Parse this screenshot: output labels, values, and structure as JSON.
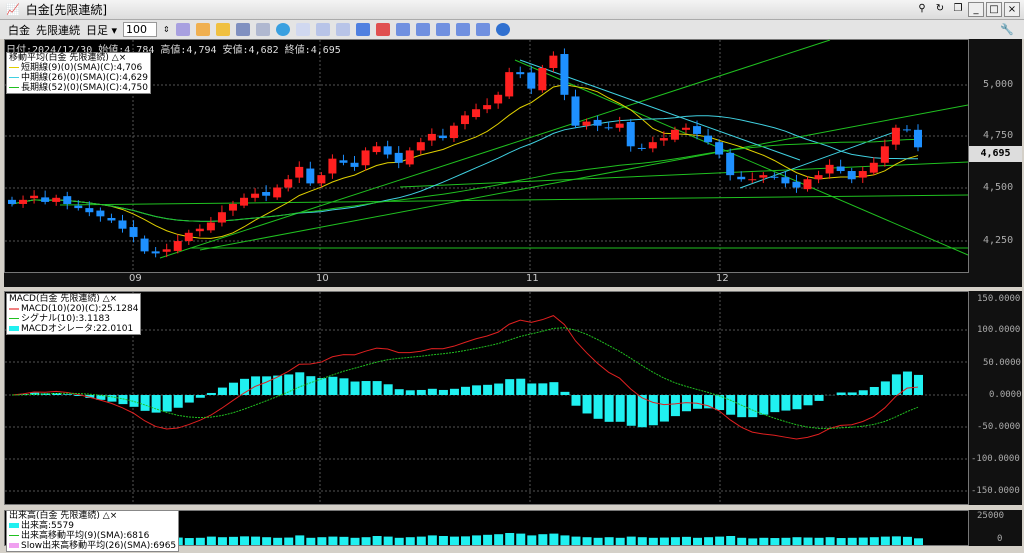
{
  "window": {
    "title": "白金[先限連続]"
  },
  "toolbar": {
    "symbol": "白金",
    "contract": "先限連続",
    "period": "日足",
    "count": "100"
  },
  "info": {
    "text": "日付:2024/12/30 始値:4,784 高値:4,794 安値:4,682 終値:4,695"
  },
  "ma_legend": {
    "title": "移動平均(白金 先限連続)",
    "items": [
      "短期線(9)(0)(SMA)(C):4,706",
      "中期線(26)(0)(SMA)(C):4,629",
      "長期線(52)(0)(SMA)(C):4,750"
    ]
  },
  "macd_legend": {
    "title": "MACD(白金 先限連続)",
    "items": [
      "MACD(10)(20)(C):25.1284",
      "シグナル(10):3.1183",
      "MACDオシレータ:22.0101"
    ]
  },
  "vol_legend": {
    "title": "出来高(白金 先限連続)",
    "items": [
      "出来高:5579",
      "出来高移動平均(9)(SMA):6816",
      "Slow出来高移動平均(26)(SMA):6965"
    ]
  },
  "price_axis": {
    "ticks": [
      "5,000",
      "4,750",
      "4,500",
      "4,250"
    ],
    "current": "4,695"
  },
  "macd_axis": {
    "ticks": [
      "150.0000",
      "100.0000",
      "50.0000",
      "0.0000",
      "-50.0000",
      "-100.0000",
      "-150.0000"
    ]
  },
  "vol_axis": {
    "ticks": [
      "25000",
      "0"
    ]
  },
  "x_axis": {
    "labels": [
      "09",
      "10",
      "11",
      "12"
    ]
  },
  "colors": {
    "up": "#ff2020",
    "down": "#1e90ff",
    "short": "#e0d000",
    "mid": "#40d0e0",
    "long": "#20c020",
    "macd": "#e02020",
    "signal": "#20c020",
    "osc": "#20f0f0"
  },
  "chart_data": {
    "type": "candlestick",
    "closes": [
      4420,
      4440,
      4460,
      4430,
      4450,
      4420,
      4400,
      4380,
      4360,
      4340,
      4300,
      4260,
      4190,
      4180,
      4200,
      4240,
      4280,
      4300,
      4330,
      4380,
      4420,
      4450,
      4470,
      4460,
      4500,
      4540,
      4600,
      4520,
      4560,
      4640,
      4620,
      4600,
      4680,
      4700,
      4660,
      4620,
      4680,
      4720,
      4760,
      4740,
      4800,
      4850,
      4880,
      4900,
      4950,
      5060,
      5050,
      4980,
      5080,
      5140,
      4950,
      4800,
      4820,
      4800,
      4790,
      4810,
      4700,
      4690,
      4720,
      4740,
      4780,
      4790,
      4760,
      4720,
      4660,
      4560,
      4540,
      4540,
      4560,
      4550,
      4520,
      4500,
      4540,
      4560,
      4610,
      4580,
      4540,
      4580,
      4620,
      4700,
      4790,
      4780,
      4695
    ],
    "volumes": [
      6000,
      7000,
      7500,
      7200,
      6800,
      6500,
      7000,
      6000,
      5500,
      5000,
      5200,
      6000,
      7000,
      6500,
      6000,
      6200,
      5800,
      6000,
      7000,
      6500,
      6800,
      7200,
      7000,
      6500,
      6000,
      6200,
      8000,
      6000,
      6500,
      7000,
      6800,
      6000,
      6500,
      7500,
      7000,
      6000,
      6500,
      7000,
      8000,
      7500,
      7000,
      7200,
      8000,
      8500,
      9000,
      10000,
      9500,
      8000,
      9000,
      9500,
      8000,
      7000,
      6500,
      6000,
      6500,
      6000,
      7000,
      6500,
      6000,
      6200,
      6500,
      6800,
      6000,
      6500,
      7000,
      7500,
      6000,
      5500,
      6000,
      5800,
      6000,
      6500,
      6200,
      6000,
      6500,
      5800,
      6000,
      6200,
      6500,
      7000,
      7200,
      6800,
      5579
    ],
    "price_range": [
      4150,
      5200
    ],
    "macd_range": [
      -160,
      160
    ]
  }
}
